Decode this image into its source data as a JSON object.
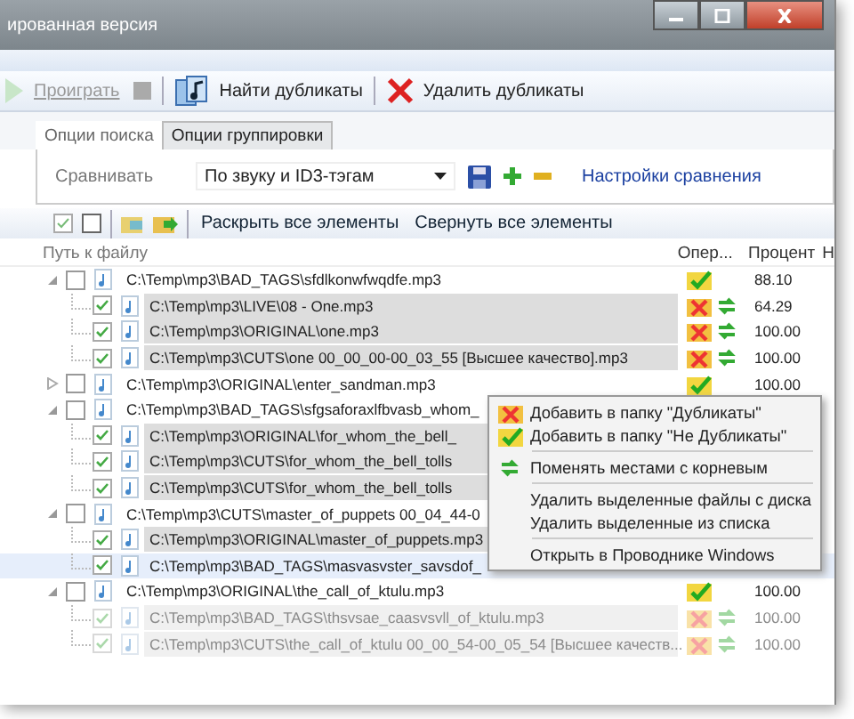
{
  "window": {
    "title": "ированная версия"
  },
  "toolbar": [
    {
      "kind": "play",
      "label": "Проиграть",
      "disabled": true
    },
    {
      "kind": "stop",
      "disabled": true
    },
    {
      "kind": "find",
      "label": "Найти дубликаты",
      "disabled": false
    },
    {
      "kind": "delete",
      "label": "Удалить дубликаты",
      "disabled": false
    }
  ],
  "tabs": [
    {
      "label": "Опции поиска",
      "selected": true
    },
    {
      "label": "Опции группировки",
      "selected": false
    }
  ],
  "compare": {
    "label": "Сравнивать",
    "value": "По звуку и ID3-тэгам",
    "link": "Настройки сравнения"
  },
  "tree_toolbar": {
    "expand": "Раскрыть все элементы",
    "collapse": "Свернуть все элементы"
  },
  "columns": [
    "Путь к файлу",
    "Опер...",
    "Процент",
    "Н"
  ],
  "rows": [
    {
      "path": "C:\\Temp\\mp3\\BAD_TAGS\\sfdlkonwfwqdfe.mp3",
      "checked": false,
      "expanded": true,
      "kind": "keep",
      "percent": "88.10",
      "children": [
        {
          "path": "C:\\Temp\\mp3\\LIVE\\08 - One.mp3",
          "checked": true,
          "selected": false,
          "disabled": false,
          "kind": "dup",
          "percent": "64.29"
        },
        {
          "path": "C:\\Temp\\mp3\\ORIGINAL\\one.mp3",
          "checked": true,
          "selected": false,
          "disabled": false,
          "kind": "dup",
          "percent": "100.00"
        },
        {
          "path": "C:\\Temp\\mp3\\CUTS\\one 00_00_00-00_03_55 [Высшее качество].mp3",
          "checked": true,
          "selected": false,
          "disabled": false,
          "kind": "dup",
          "percent": "100.00"
        }
      ]
    },
    {
      "path": "C:\\Temp\\mp3\\ORIGINAL\\enter_sandman.mp3",
      "checked": false,
      "expanded": false,
      "kind": "keep",
      "percent": "100.00",
      "children": []
    },
    {
      "path": "C:\\Temp\\mp3\\BAD_TAGS\\sfgsaforaxlfbvasb_whom_",
      "checked": false,
      "expanded": true,
      "children": [
        {
          "path": "C:\\Temp\\mp3\\ORIGINAL\\for_whom_the_bell_",
          "checked": true,
          "selected": false,
          "disabled": false
        },
        {
          "path": "C:\\Temp\\mp3\\CUTS\\for_whom_the_bell_tolls",
          "checked": true,
          "selected": false,
          "disabled": false
        },
        {
          "path": "C:\\Temp\\mp3\\CUTS\\for_whom_the_bell_tolls",
          "checked": true,
          "selected": false,
          "disabled": false
        }
      ]
    },
    {
      "path": "C:\\Temp\\mp3\\CUTS\\master_of_puppets 00_04_44-0",
      "checked": false,
      "expanded": true,
      "children": [
        {
          "path": "C:\\Temp\\mp3\\ORIGINAL\\master_of_puppets.mp3",
          "checked": true,
          "selected": false,
          "disabled": false
        },
        {
          "path": "C:\\Temp\\mp3\\BAD_TAGS\\masvasvster_savsdof_",
          "checked": true,
          "selected": true,
          "disabled": false
        }
      ]
    },
    {
      "path": "C:\\Temp\\mp3\\ORIGINAL\\the_call_of_ktulu.mp3",
      "checked": false,
      "expanded": true,
      "kind": "keep",
      "percent": "100.00",
      "children": [
        {
          "path": "C:\\Temp\\mp3\\BAD_TAGS\\thsvsae_caasvsvll_of_ktulu.mp3",
          "checked": true,
          "selected": false,
          "disabled": true,
          "kind": "dup",
          "percent": "100.00"
        },
        {
          "path": "C:\\Temp\\mp3\\CUTS\\the_call_of_ktulu 00_00_54-00_05_54 [Высшее качеств...",
          "checked": true,
          "selected": false,
          "disabled": true,
          "kind": "dup",
          "percent": "100.00"
        }
      ]
    }
  ],
  "context_menu": [
    {
      "kind": "dup",
      "label": "Добавить в папку \"Дубликаты\""
    },
    {
      "kind": "keep",
      "label": "Добавить в папку \"Не Дубликаты\""
    },
    {
      "kind": "separator"
    },
    {
      "kind": "swap",
      "label": "Поменять местами с корневым"
    },
    {
      "kind": "separator"
    },
    {
      "kind": "plain",
      "label": "Удалить выделенные файлы с диска"
    },
    {
      "kind": "plain",
      "label": "Удалить выделенные из списка"
    },
    {
      "kind": "separator"
    },
    {
      "kind": "plain",
      "label": "Открыть в Проводнике Windows"
    }
  ]
}
